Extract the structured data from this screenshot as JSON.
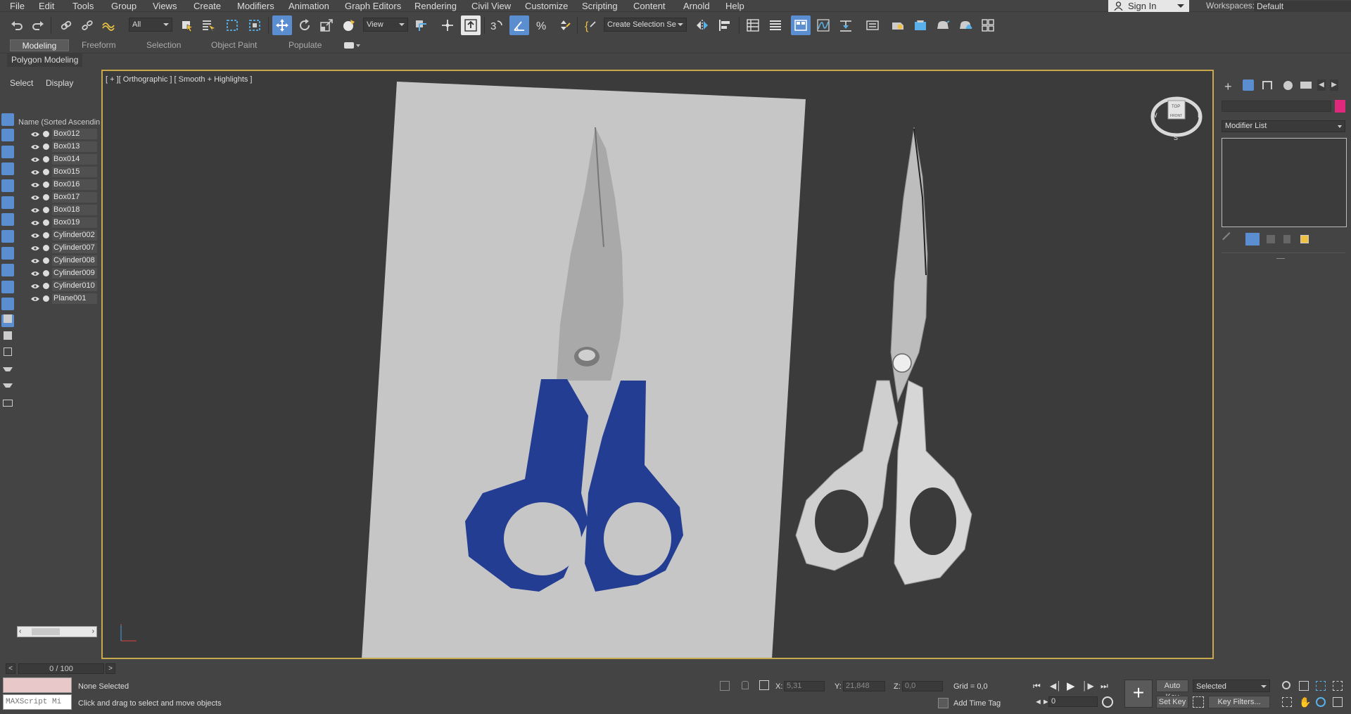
{
  "menubar": {
    "items": [
      "File",
      "Edit",
      "Tools",
      "Group",
      "Views",
      "Create",
      "Modifiers",
      "Animation",
      "Graph Editors",
      "Rendering",
      "Civil View",
      "Customize",
      "Scripting",
      "Content",
      "Arnold",
      "Help"
    ],
    "signin": "Sign In",
    "workspaces_label": "Workspaces:",
    "workspace_value": "Default"
  },
  "toolbar": {
    "filter_value": "All",
    "refcoord_value": "View",
    "selection_set_value": "Create Selection Se"
  },
  "ribbon": {
    "tabs": [
      "Modeling",
      "Freeform",
      "Selection",
      "Object Paint",
      "Populate"
    ],
    "active_tab": "Modeling",
    "panel_label": "Polygon Modeling"
  },
  "scene_explorer": {
    "tab_select": "Select",
    "tab_display": "Display",
    "column_header": "Name (Sorted Ascendin",
    "objects": [
      "Box012",
      "Box013",
      "Box014",
      "Box015",
      "Box016",
      "Box017",
      "Box018",
      "Box019",
      "Cylinder002",
      "Cylinder007",
      "Cylinder008",
      "Cylinder009",
      "Cylinder010",
      "Plane001"
    ]
  },
  "viewport": {
    "label": "[ + ][ Orthographic ] [ Smooth + Highlights ]",
    "viewcube_top": "TOP",
    "viewcube_front": "FRONT",
    "compass_w": "W",
    "compass_e": "E",
    "compass_s": "S"
  },
  "command_panel": {
    "modifier_list": "Modifier List",
    "color_swatch": "#e0287d"
  },
  "timeline": {
    "frame_display": "0 / 100",
    "prev": "<",
    "next": ">"
  },
  "status": {
    "maxscript_label": "MAXScript Mi",
    "selection_status": "None Selected",
    "prompt": "Click and drag to select and move objects",
    "x_label": "X:",
    "x_value": "5,31",
    "y_label": "Y:",
    "y_value": "21,848",
    "z_label": "Z:",
    "z_value": "0,0",
    "grid": "Grid = 0,0",
    "add_time_tag": "Add Time Tag",
    "auto_key": "Auto Key",
    "set_key": "Set Key",
    "key_mode_value": "Selected",
    "key_filters": "Key Filters...",
    "current_frame": "0"
  }
}
